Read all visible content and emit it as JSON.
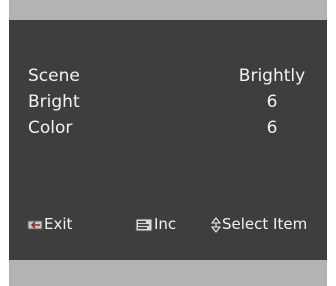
{
  "menu": {
    "items": [
      {
        "label": "Scene",
        "value": "Brightly"
      },
      {
        "label": "Bright",
        "value": "6"
      },
      {
        "label": "Color",
        "value": "6"
      }
    ]
  },
  "footer": {
    "exit": {
      "label": "Exit",
      "icon": "exit-key-icon"
    },
    "inc": {
      "label": "Inc",
      "icon": "menu-key-icon"
    },
    "select": {
      "label": "Select Item",
      "icon": "up-down-arrows-icon"
    }
  },
  "colors": {
    "panel": "#3e3e3e",
    "frame": "#b3b3b3",
    "text": "#f2f2f2"
  }
}
